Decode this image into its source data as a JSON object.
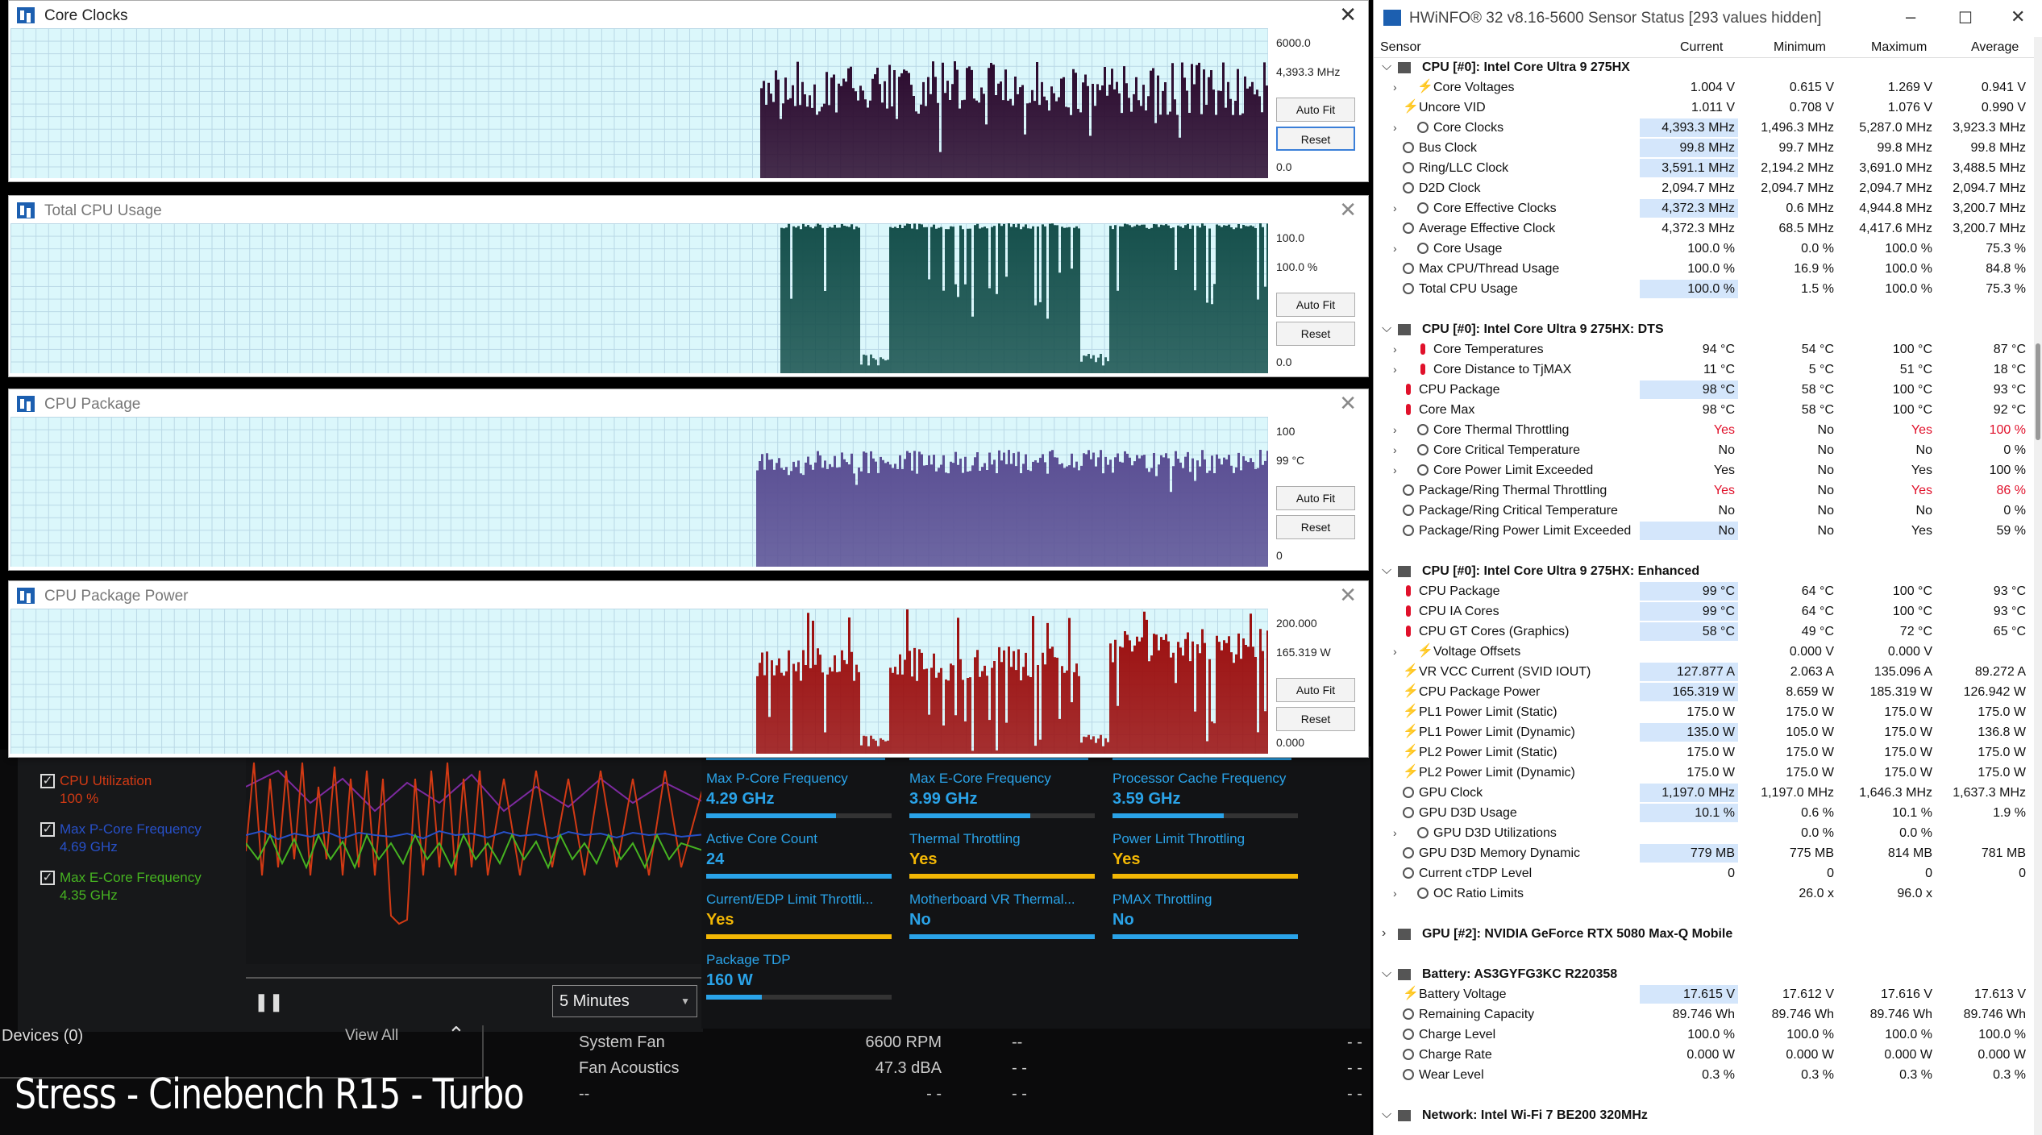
{
  "overlay_caption": "Stress - Cinebench R15 - Turbo",
  "graph_windows": [
    {
      "title": "Core Clocks",
      "max": "6000.0",
      "current": "4,393.3 MHz",
      "min": "0.0",
      "color": "#2b0a2e",
      "active": true,
      "buttons": {
        "autofit": "Auto Fit",
        "reset": "Reset"
      }
    },
    {
      "title": "Total CPU Usage",
      "max": "100.0",
      "current": "100.0 %",
      "min": "0.0",
      "color": "#16504c",
      "active": false,
      "buttons": {
        "autofit": "Auto Fit",
        "reset": "Reset"
      }
    },
    {
      "title": "CPU Package",
      "max": "100",
      "current": "99 °C",
      "min": "0",
      "color": "#5a4e93",
      "active": false,
      "buttons": {
        "autofit": "Auto Fit",
        "reset": "Reset"
      }
    },
    {
      "title": "CPU Package Power",
      "max": "200.000",
      "current": "165.319 W",
      "min": "0.000",
      "color": "#9b0c0c",
      "active": false,
      "buttons": {
        "autofit": "Auto Fit",
        "reset": "Reset"
      }
    }
  ],
  "xtu": {
    "legend": [
      {
        "label": "CPU Utilization",
        "value": "100 %",
        "color": "#d23a14"
      },
      {
        "label": "Max P-Core Frequency",
        "value": "4.69 GHz",
        "color": "#2750c8"
      },
      {
        "label": "Max E-Core Frequency",
        "value": "4.35 GHz",
        "color": "#46b321"
      }
    ],
    "time_window": "5 Minutes",
    "cards": [
      {
        "label": "Max P-Core Frequency",
        "value": "4.29 GHz",
        "fill": 0.7,
        "color": "#2aa3e8"
      },
      {
        "label": "Max E-Core Frequency",
        "value": "3.99 GHz",
        "fill": 0.65,
        "color": "#2aa3e8"
      },
      {
        "label": "Processor Cache Frequency",
        "value": "3.59 GHz",
        "fill": 0.6,
        "color": "#2aa3e8"
      },
      {
        "label": "Active Core Count",
        "value": "24",
        "fill": 1.0,
        "color": "#2aa3e8"
      },
      {
        "label": "Thermal Throttling",
        "value": "Yes",
        "fill": 1.0,
        "color": "#f2b705"
      },
      {
        "label": "Power Limit Throttling",
        "value": "Yes",
        "fill": 1.0,
        "color": "#f2b705"
      },
      {
        "label": "Current/EDP Limit Throttli...",
        "value": "Yes",
        "fill": 1.0,
        "color": "#f2b705"
      },
      {
        "label": "Motherboard VR Thermal...",
        "value": "No",
        "fill": 1.0,
        "color": "#2aa3e8"
      },
      {
        "label": "PMAX Throttling",
        "value": "No",
        "fill": 1.0,
        "color": "#2aa3e8"
      },
      {
        "label": "Package TDP",
        "value": "160 W",
        "fill": 0.3,
        "color": "#2aa3e8"
      }
    ],
    "devices": {
      "label": "Devices (0)",
      "view_all": "View All"
    },
    "fans": [
      {
        "name": "System Fan",
        "value": "6600 RPM",
        "a": "--",
        "b": "- -"
      },
      {
        "name": "Fan Acoustics",
        "value": "47.3 dBA",
        "a": "- -",
        "b": "- -"
      },
      {
        "name": "--",
        "value": "- -",
        "a": "- -",
        "b": "- -"
      }
    ]
  },
  "hwinfo": {
    "title": "HWiNFO® 32 v8.16-5600 Sensor Status [293 values hidden]",
    "columns": {
      "sensor": "Sensor",
      "current": "Current",
      "minimum": "Minimum",
      "maximum": "Maximum",
      "average": "Average"
    },
    "groups": [
      {
        "name": "CPU [#0]: Intel Core Ultra 9 275HX",
        "expanded": true,
        "rows": [
          {
            "n": "Core Voltages",
            "i": "volt",
            "sub": true,
            "cur": "1.004 V",
            "min": "0.615 V",
            "max": "1.269 V",
            "avg": "0.941 V"
          },
          {
            "n": "Uncore VID",
            "i": "volt",
            "cur": "1.011 V",
            "min": "0.708 V",
            "max": "1.076 V",
            "avg": "0.990 V"
          },
          {
            "n": "Core Clocks",
            "i": "clock",
            "sub": true,
            "hl": true,
            "cur": "4,393.3 MHz",
            "min": "1,496.3 MHz",
            "max": "5,287.0 MHz",
            "avg": "3,923.3 MHz"
          },
          {
            "n": "Bus Clock",
            "i": "clock",
            "hl": true,
            "cur": "99.8 MHz",
            "min": "99.7 MHz",
            "max": "99.8 MHz",
            "avg": "99.8 MHz"
          },
          {
            "n": "Ring/LLC Clock",
            "i": "clock",
            "hl": true,
            "cur": "3,591.1 MHz",
            "min": "2,194.2 MHz",
            "max": "3,691.0 MHz",
            "avg": "3,488.5 MHz"
          },
          {
            "n": "D2D Clock",
            "i": "clock",
            "cur": "2,094.7 MHz",
            "min": "2,094.7 MHz",
            "max": "2,094.7 MHz",
            "avg": "2,094.7 MHz"
          },
          {
            "n": "Core Effective Clocks",
            "i": "clock",
            "sub": true,
            "hl": true,
            "cur": "4,372.3 MHz",
            "min": "0.6 MHz",
            "max": "4,944.8 MHz",
            "avg": "3,200.7 MHz"
          },
          {
            "n": "Average Effective Clock",
            "i": "clock",
            "cur": "4,372.3 MHz",
            "min": "68.5 MHz",
            "max": "4,417.6 MHz",
            "avg": "3,200.7 MHz"
          },
          {
            "n": "Core Usage",
            "i": "clock",
            "sub": true,
            "cur": "100.0 %",
            "min": "0.0 %",
            "max": "100.0 %",
            "avg": "75.3 %"
          },
          {
            "n": "Max CPU/Thread Usage",
            "i": "clock",
            "cur": "100.0 %",
            "min": "16.9 %",
            "max": "100.0 %",
            "avg": "84.8 %"
          },
          {
            "n": "Total CPU Usage",
            "i": "clock",
            "hl": true,
            "cur": "100.0 %",
            "min": "1.5 %",
            "max": "100.0 %",
            "avg": "75.3 %"
          }
        ]
      },
      {
        "name": "CPU [#0]: Intel Core Ultra 9 275HX: DTS",
        "expanded": true,
        "rows": [
          {
            "n": "Core Temperatures",
            "i": "temp",
            "sub": true,
            "cur": "94 °C",
            "min": "54 °C",
            "max": "100 °C",
            "avg": "87 °C"
          },
          {
            "n": "Core Distance to TjMAX",
            "i": "temp",
            "sub": true,
            "cur": "11 °C",
            "min": "5 °C",
            "max": "51 °C",
            "avg": "18 °C"
          },
          {
            "n": "CPU Package",
            "i": "temp",
            "hl": true,
            "cur": "98 °C",
            "min": "58 °C",
            "max": "100 °C",
            "avg": "93 °C"
          },
          {
            "n": "Core Max",
            "i": "temp",
            "cur": "98 °C",
            "min": "58 °C",
            "max": "100 °C",
            "avg": "92 °C"
          },
          {
            "n": "Core Thermal Throttling",
            "i": "clock",
            "sub": true,
            "cur": "Yes",
            "min": "No",
            "max": "Yes",
            "avg": "100 %",
            "red": true
          },
          {
            "n": "Core Critical Temperature",
            "i": "clock",
            "sub": true,
            "cur": "No",
            "min": "No",
            "max": "No",
            "avg": "0 %"
          },
          {
            "n": "Core Power Limit Exceeded",
            "i": "clock",
            "sub": true,
            "cur": "Yes",
            "min": "No",
            "max": "Yes",
            "avg": "100 %"
          },
          {
            "n": "Package/Ring Thermal Throttling",
            "i": "clock",
            "cur": "Yes",
            "min": "No",
            "max": "Yes",
            "avg": "86 %",
            "red": true
          },
          {
            "n": "Package/Ring Critical Temperature",
            "i": "clock",
            "cur": "No",
            "min": "No",
            "max": "No",
            "avg": "0 %"
          },
          {
            "n": "Package/Ring Power Limit Exceeded",
            "i": "clock",
            "hl": true,
            "cur": "No",
            "min": "No",
            "max": "Yes",
            "avg": "59 %"
          }
        ]
      },
      {
        "name": "CPU [#0]: Intel Core Ultra 9 275HX: Enhanced",
        "expanded": true,
        "rows": [
          {
            "n": "CPU Package",
            "i": "temp",
            "hl": true,
            "cur": "99 °C",
            "min": "64 °C",
            "max": "100 °C",
            "avg": "93 °C"
          },
          {
            "n": "CPU IA Cores",
            "i": "temp",
            "hl": true,
            "cur": "99 °C",
            "min": "64 °C",
            "max": "100 °C",
            "avg": "93 °C"
          },
          {
            "n": "CPU GT Cores (Graphics)",
            "i": "temp",
            "hl": true,
            "cur": "58 °C",
            "min": "49 °C",
            "max": "72 °C",
            "avg": "65 °C"
          },
          {
            "n": "Voltage Offsets",
            "i": "volt",
            "sub": true,
            "cur": "",
            "min": "0.000 V",
            "max": "0.000 V",
            "avg": ""
          },
          {
            "n": "VR VCC Current (SVID IOUT)",
            "i": "volt",
            "hl": true,
            "cur": "127.877 A",
            "min": "2.063 A",
            "max": "135.096 A",
            "avg": "89.272 A"
          },
          {
            "n": "CPU Package Power",
            "i": "volt",
            "hl": true,
            "cur": "165.319 W",
            "min": "8.659 W",
            "max": "185.319 W",
            "avg": "126.942 W"
          },
          {
            "n": "PL1 Power Limit (Static)",
            "i": "volt",
            "cur": "175.0 W",
            "min": "175.0 W",
            "max": "175.0 W",
            "avg": "175.0 W"
          },
          {
            "n": "PL1 Power Limit (Dynamic)",
            "i": "volt",
            "hl": true,
            "cur": "135.0 W",
            "min": "105.0 W",
            "max": "175.0 W",
            "avg": "136.8 W"
          },
          {
            "n": "PL2 Power Limit (Static)",
            "i": "volt",
            "cur": "175.0 W",
            "min": "175.0 W",
            "max": "175.0 W",
            "avg": "175.0 W"
          },
          {
            "n": "PL2 Power Limit (Dynamic)",
            "i": "volt",
            "cur": "175.0 W",
            "min": "175.0 W",
            "max": "175.0 W",
            "avg": "175.0 W"
          },
          {
            "n": "GPU Clock",
            "i": "clock",
            "hl": true,
            "cur": "1,197.0 MHz",
            "min": "1,197.0 MHz",
            "max": "1,646.3 MHz",
            "avg": "1,637.3 MHz"
          },
          {
            "n": "GPU D3D Usage",
            "i": "clock",
            "hl": true,
            "cur": "10.1 %",
            "min": "0.6 %",
            "max": "10.1 %",
            "avg": "1.9 %"
          },
          {
            "n": "GPU D3D Utilizations",
            "i": "clock",
            "sub": true,
            "cur": "",
            "min": "0.0 %",
            "max": "0.0 %",
            "avg": ""
          },
          {
            "n": "GPU D3D Memory Dynamic",
            "i": "clock",
            "hl": true,
            "cur": "779 MB",
            "min": "775 MB",
            "max": "814 MB",
            "avg": "781 MB"
          },
          {
            "n": "Current cTDP Level",
            "i": "clock",
            "cur": "0",
            "min": "0",
            "max": "0",
            "avg": "0"
          },
          {
            "n": "OC Ratio Limits",
            "i": "clock",
            "sub": true,
            "cur": "",
            "min": "26.0 x",
            "max": "96.0 x",
            "avg": ""
          }
        ]
      },
      {
        "name": "GPU [#2]: NVIDIA  GeForce RTX 5080 Max-Q Mobile",
        "expanded": false,
        "rows": []
      },
      {
        "name": "Battery: AS3GYFG3KC R220358",
        "expanded": true,
        "rows": [
          {
            "n": "Battery Voltage",
            "i": "volt",
            "hl": true,
            "cur": "17.615 V",
            "min": "17.612 V",
            "max": "17.616 V",
            "avg": "17.613 V"
          },
          {
            "n": "Remaining Capacity",
            "i": "clock",
            "cur": "89.746 Wh",
            "min": "89.746 Wh",
            "max": "89.746 Wh",
            "avg": "89.746 Wh"
          },
          {
            "n": "Charge Level",
            "i": "clock",
            "cur": "100.0 %",
            "min": "100.0 %",
            "max": "100.0 %",
            "avg": "100.0 %"
          },
          {
            "n": "Charge Rate",
            "i": "clock",
            "cur": "0.000 W",
            "min": "0.000 W",
            "max": "0.000 W",
            "avg": "0.000 W"
          },
          {
            "n": "Wear Level",
            "i": "clock",
            "cur": "0.3 %",
            "min": "0.3 %",
            "max": "0.3 %",
            "avg": "0.3 %"
          }
        ]
      },
      {
        "name": "Network: Intel Wi-Fi 7 BE200 320MHz",
        "expanded": true,
        "rows": []
      }
    ]
  }
}
